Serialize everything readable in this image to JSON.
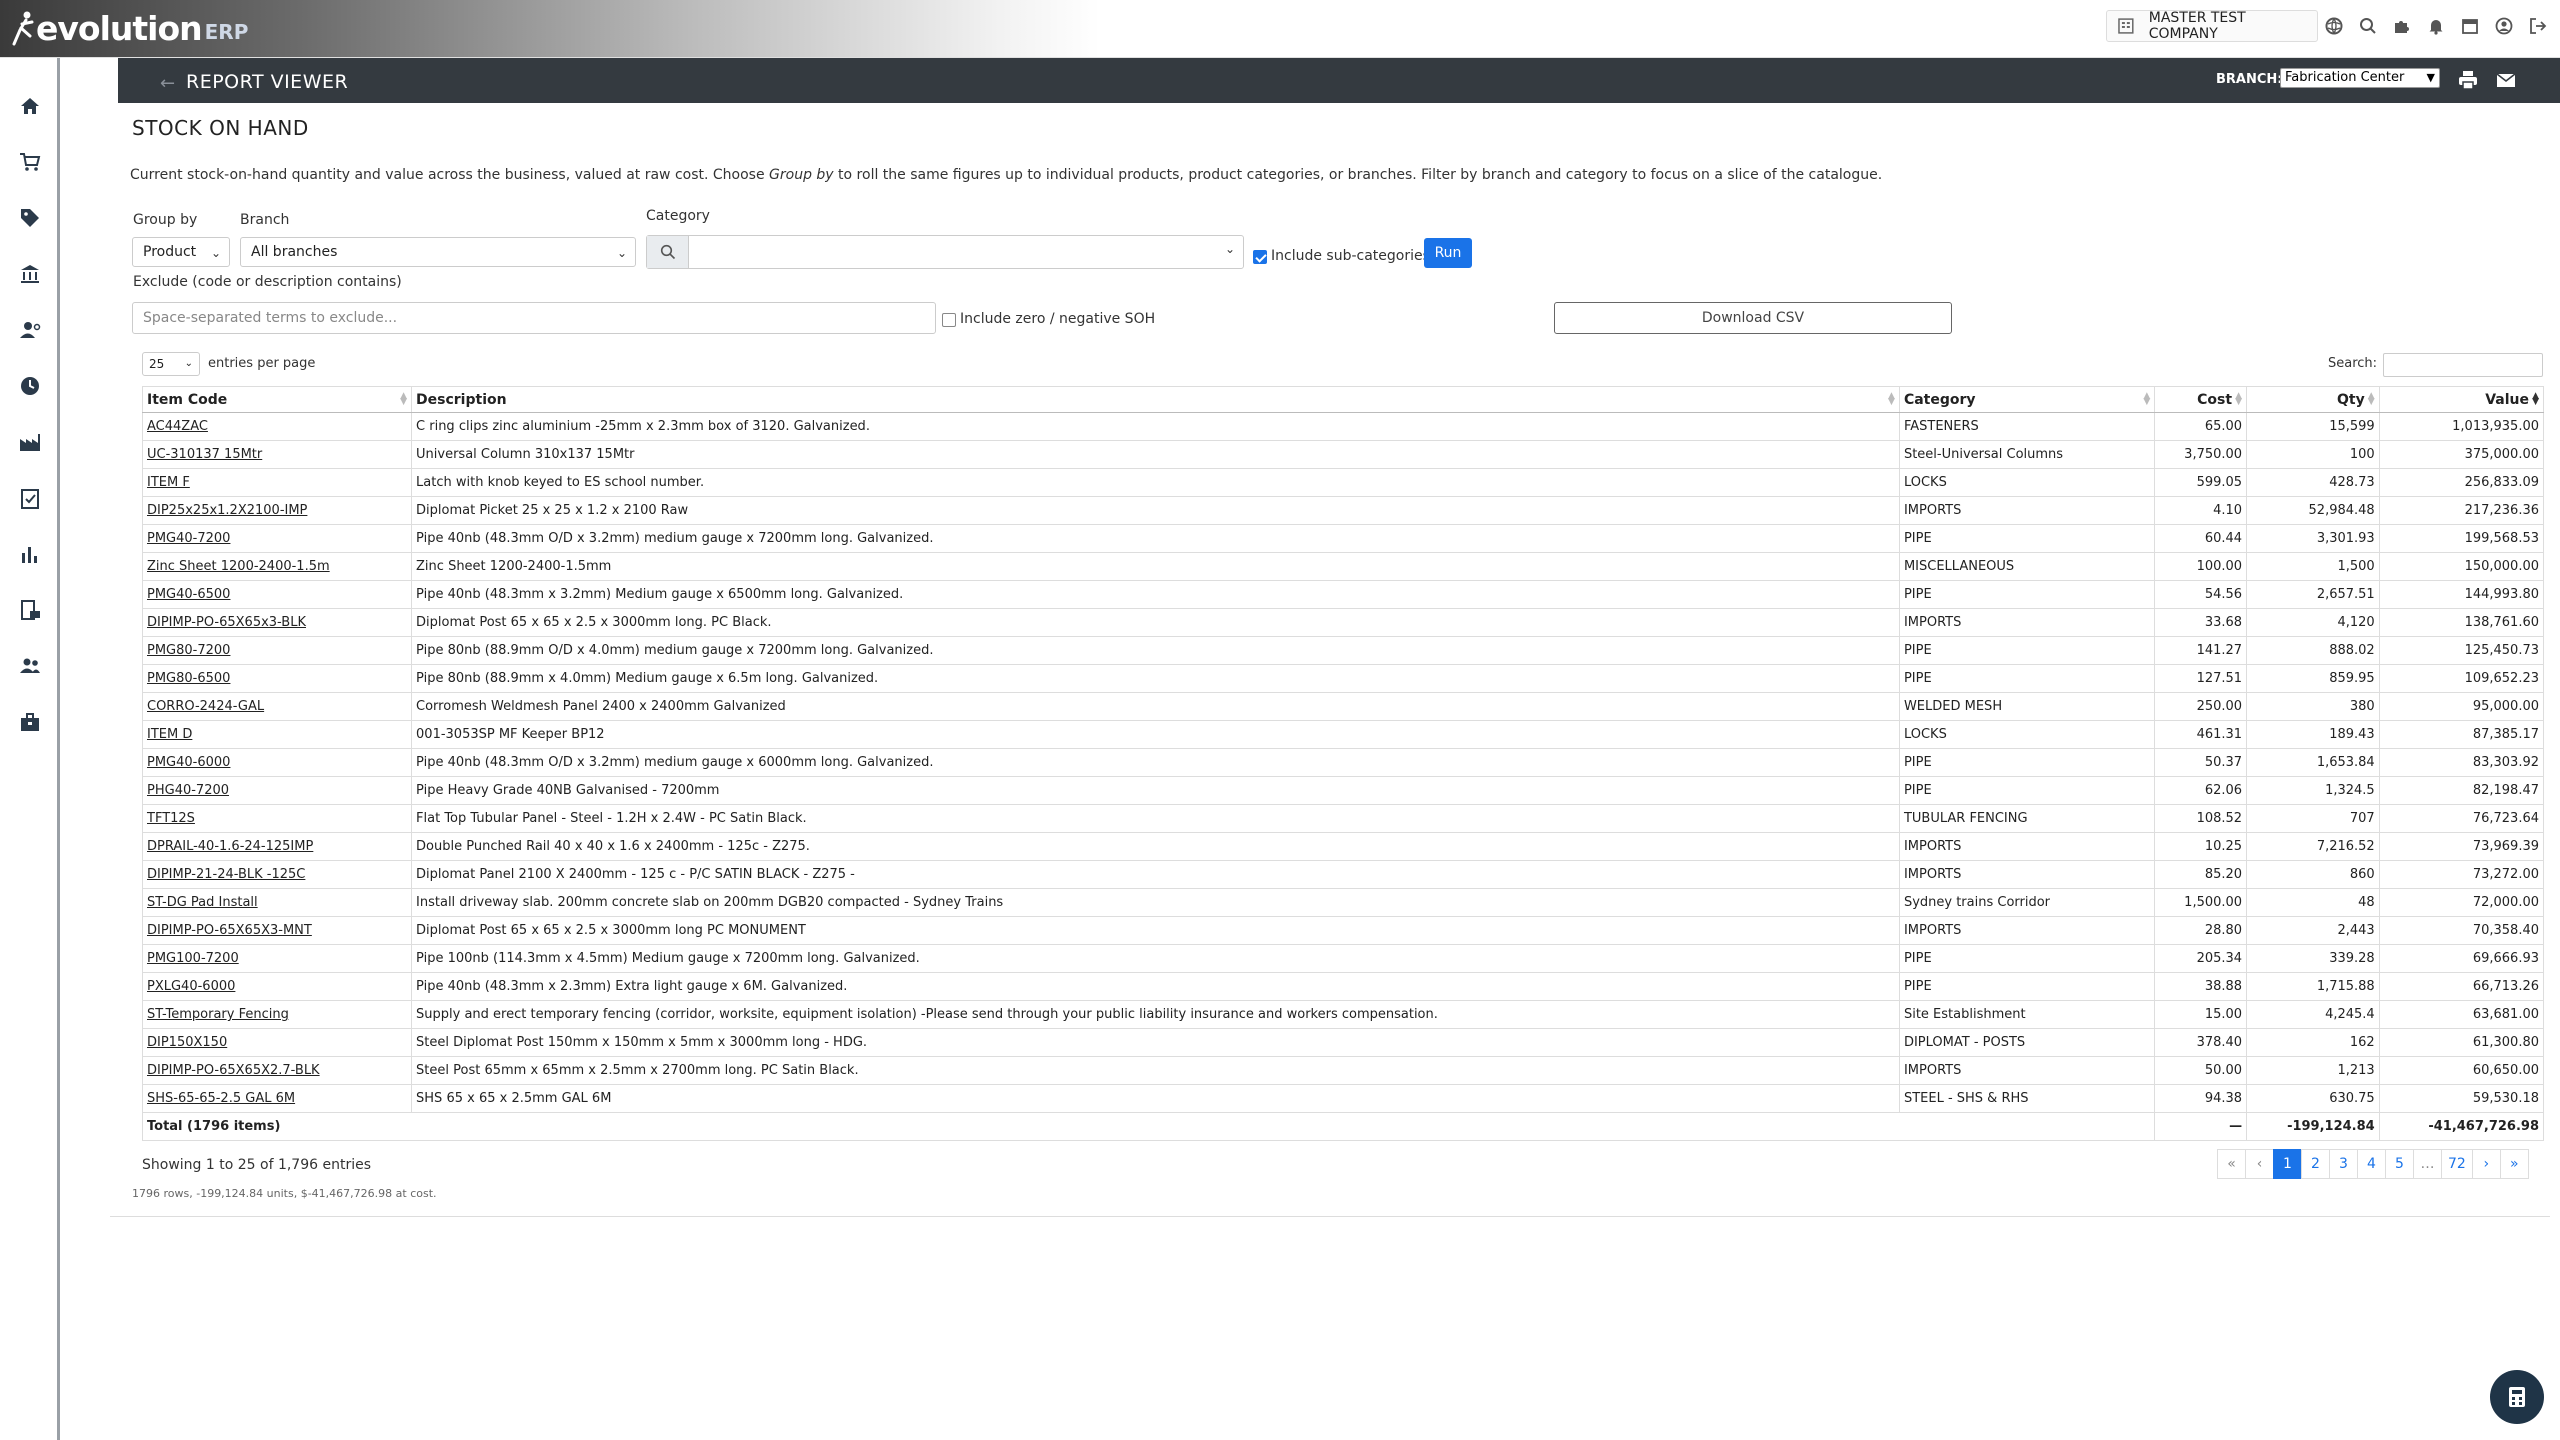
{
  "app": {
    "logo_main": "evolution",
    "logo_suffix": "ERP",
    "company": "MASTER TEST COMPANY"
  },
  "header": {
    "title": "REPORT VIEWER",
    "branch_label": "BRANCH:",
    "branch_value": "Fabrication Center"
  },
  "report": {
    "title": "STOCK ON HAND",
    "description_pre": "Current stock-on-hand quantity and value across the business, valued at raw cost. Choose ",
    "description_em": "Group by",
    "description_post": " to roll the same figures up to individual products, product categories, or branches. Filter by branch and category to focus on a slice of the catalogue."
  },
  "filters": {
    "group_by_label": "Group by",
    "group_by_value": "Product",
    "branch_label": "Branch",
    "branch_value": "All branches",
    "category_label": "Category",
    "category_value": "",
    "include_sub_label": "Include sub-categories",
    "include_sub_checked": true,
    "run_label": "Run",
    "exclude_label": "Exclude (code or description contains)",
    "exclude_placeholder": "Space-separated terms to exclude...",
    "zero_label": "Include zero / negative SOH",
    "zero_checked": false,
    "csv_label": "Download CSV"
  },
  "table_controls": {
    "page_length": "25",
    "entries_label": "entries per page",
    "search_label": "Search:"
  },
  "table": {
    "columns": [
      "Item Code",
      "Description",
      "Category",
      "Cost",
      "Qty",
      "Value"
    ],
    "rows": [
      [
        "AC44ZAC",
        "C ring clips zinc aluminium -25mm x 2.3mm box of 3120. Galvanized.",
        "FASTENERS",
        "65.00",
        "15,599",
        "1,013,935.00"
      ],
      [
        "UC-310137 15Mtr",
        "Universal Column 310x137 15Mtr",
        "Steel-Universal Columns",
        "3,750.00",
        "100",
        "375,000.00"
      ],
      [
        "ITEM F",
        "Latch with knob keyed to ES school number.",
        "LOCKS",
        "599.05",
        "428.73",
        "256,833.09"
      ],
      [
        "DIP25x25x1.2X2100-IMP",
        "Diplomat Picket 25 x 25 x 1.2 x 2100 Raw",
        "IMPORTS",
        "4.10",
        "52,984.48",
        "217,236.36"
      ],
      [
        "PMG40-7200",
        "Pipe 40nb (48.3mm O/D x 3.2mm) medium gauge x 7200mm long. Galvanized.",
        "PIPE",
        "60.44",
        "3,301.93",
        "199,568.53"
      ],
      [
        "Zinc Sheet 1200-2400-1.5m",
        "Zinc Sheet 1200-2400-1.5mm",
        "MISCELLANEOUS",
        "100.00",
        "1,500",
        "150,000.00"
      ],
      [
        "PMG40-6500",
        "Pipe 40nb (48.3mm x 3.2mm) Medium gauge x 6500mm long. Galvanized.",
        "PIPE",
        "54.56",
        "2,657.51",
        "144,993.80"
      ],
      [
        "DIPIMP-PO-65X65x3-BLK",
        "Diplomat Post 65 x 65 x 2.5 x 3000mm long. PC Black.",
        "IMPORTS",
        "33.68",
        "4,120",
        "138,761.60"
      ],
      [
        "PMG80-7200",
        "Pipe 80nb (88.9mm O/D x 4.0mm) medium gauge x 7200mm long. Galvanized.",
        "PIPE",
        "141.27",
        "888.02",
        "125,450.73"
      ],
      [
        "PMG80-6500",
        "Pipe 80nb (88.9mm x 4.0mm) Medium gauge x 6.5m long. Galvanized.",
        "PIPE",
        "127.51",
        "859.95",
        "109,652.23"
      ],
      [
        "CORRO-2424-GAL",
        "Corromesh Weldmesh Panel 2400 x 2400mm Galvanized",
        "WELDED MESH",
        "250.00",
        "380",
        "95,000.00"
      ],
      [
        "ITEM D",
        "001-3053SP MF Keeper BP12",
        "LOCKS",
        "461.31",
        "189.43",
        "87,385.17"
      ],
      [
        "PMG40-6000",
        "Pipe 40nb (48.3mm O/D x 3.2mm) medium gauge x 6000mm long. Galvanized.",
        "PIPE",
        "50.37",
        "1,653.84",
        "83,303.92"
      ],
      [
        "PHG40-7200",
        "Pipe Heavy Grade 40NB Galvanised - 7200mm",
        "PIPE",
        "62.06",
        "1,324.5",
        "82,198.47"
      ],
      [
        "TFT12S",
        "Flat Top Tubular Panel - Steel - 1.2H x 2.4W - PC Satin Black.",
        "TUBULAR FENCING",
        "108.52",
        "707",
        "76,723.64"
      ],
      [
        "DPRAIL-40-1.6-24-125IMP",
        "Double Punched Rail 40 x 40 x 1.6 x 2400mm - 125c - Z275.",
        "IMPORTS",
        "10.25",
        "7,216.52",
        "73,969.39"
      ],
      [
        "DIPIMP-21-24-BLK -125C",
        "Diplomat Panel 2100 X 2400mm - 125 c - P/C SATIN BLACK - Z275 -",
        "IMPORTS",
        "85.20",
        "860",
        "73,272.00"
      ],
      [
        "ST-DG Pad Install",
        "Install driveway slab. 200mm concrete slab on 200mm DGB20 compacted - Sydney Trains",
        "Sydney trains Corridor",
        "1,500.00",
        "48",
        "72,000.00"
      ],
      [
        "DIPIMP-PO-65X65X3-MNT",
        "Diplomat Post 65 x 65 x 2.5 x 3000mm long PC MONUMENT",
        "IMPORTS",
        "28.80",
        "2,443",
        "70,358.40"
      ],
      [
        "PMG100-7200",
        "Pipe 100nb (114.3mm x 4.5mm) Medium gauge x 7200mm long. Galvanized.",
        "PIPE",
        "205.34",
        "339.28",
        "69,666.93"
      ],
      [
        "PXLG40-6000",
        "Pipe 40nb (48.3mm x 2.3mm) Extra light gauge x 6M. Galvanized.",
        "PIPE",
        "38.88",
        "1,715.88",
        "66,713.26"
      ],
      [
        "ST-Temporary Fencing",
        "Supply and erect temporary fencing (corridor, worksite, equipment isolation) -Please send through your public liability insurance and workers compensation.",
        "Site Establishment",
        "15.00",
        "4,245.4",
        "63,681.00"
      ],
      [
        "DIP150X150",
        "Steel Diplomat Post 150mm x 150mm x 5mm x 3000mm long - HDG.",
        "DIPLOMAT - POSTS",
        "378.40",
        "162",
        "61,300.80"
      ],
      [
        "DIPIMP-PO-65X65X2.7-BLK",
        "Steel Post 65mm x 65mm x 2.5mm x 2700mm long. PC Satin Black.",
        "IMPORTS",
        "50.00",
        "1,213",
        "60,650.00"
      ],
      [
        "SHS-65-65-2.5 GAL 6M",
        "SHS 65 x 65 x 2.5mm GAL 6M",
        "STEEL - SHS & RHS",
        "94.38",
        "630.75",
        "59,530.18"
      ]
    ],
    "total": {
      "label": "Total (1796 items)",
      "cost": "—",
      "qty": "-199,124.84",
      "value": "-41,467,726.98"
    }
  },
  "footer": {
    "info": "Showing 1 to 25 of 1,796 entries",
    "note": "1796 rows, -199,124.84 units, $-41,467,726.98 at cost.",
    "pager": [
      "«",
      "‹",
      "1",
      "2",
      "3",
      "4",
      "5",
      "…",
      "72",
      "›",
      "»"
    ]
  }
}
